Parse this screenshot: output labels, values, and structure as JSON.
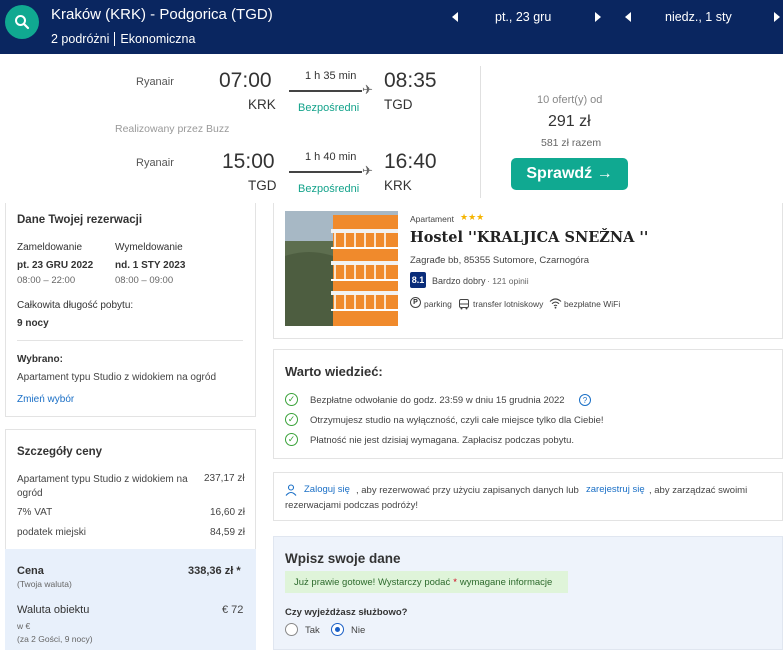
{
  "header": {
    "route": "Kraków (KRK) - Podgorica (TGD)",
    "passengers": "2 podróżni",
    "cabin": "Ekonomiczna",
    "depart_date": "pt., 23 gru",
    "return_date": "niedz., 1 sty"
  },
  "flights": {
    "outbound": {
      "carrier": "Ryanair",
      "dep_time": "07:00",
      "dep_code": "KRK",
      "duration": "1 h 35 min",
      "stops": "Bezpośredni",
      "arr_time": "08:35",
      "arr_code": "TGD"
    },
    "operated_by": "Realizowany przez Buzz",
    "inbound": {
      "carrier": "Ryanair",
      "dep_time": "15:00",
      "dep_code": "TGD",
      "duration": "1 h 40 min",
      "stops": "Bezpośredni",
      "arr_time": "16:40",
      "arr_code": "KRK"
    },
    "offers": "10 ofert(y) od",
    "price": "291 zł",
    "price_total": "581 zł razem",
    "check_label": "Sprawdź →"
  },
  "reservation": {
    "title": "Dane Twojej rezerwacji",
    "checkin_label": "Zameldowanie",
    "checkin_date": "pt. 23 GRU 2022",
    "checkin_hours": "08:00 – 22:00",
    "checkout_label": "Wymeldowanie",
    "checkout_date": "nd. 1 STY 2023",
    "checkout_hours": "08:00 – 09:00",
    "length_label": "Całkowita długość pobytu:",
    "length_value": "9 nocy",
    "selected_label": "Wybrano:",
    "selected_value": "Apartament typu Studio z widokiem na ogród",
    "change_link": "Zmień wybór"
  },
  "price_details": {
    "title": "Szczegóły ceny",
    "item_label": "Apartament typu Studio z widokiem na ogród",
    "item_value": "237,17 zł",
    "vat_label": "7% VAT",
    "vat_value": "16,60 zł",
    "tax_label": "podatek miejski",
    "tax_value": "84,59 zł",
    "total_label": "Cena",
    "total_note": "(Twoja waluta)",
    "total_value": "338,36 zł *",
    "currency_label": "Waluta obiektu",
    "currency_sub": "w €",
    "currency_note": "(za 2 Gości, 9 nocy)",
    "currency_value": "€ 72"
  },
  "hotel": {
    "type": "Apartament",
    "stars": "★★★",
    "name": "Hostel ''KRALJICA SNEŽNA ''",
    "address": "Zagrađe bb, 85355 Sutomore, Czarnogóra",
    "score": "8.1",
    "score_label": "Bardzo dobry",
    "reviews": "· 121 opinii",
    "amenity_parking": "parking",
    "amenity_transfer": "transfer lotniskowy",
    "amenity_wifi": "bezpłatne WiFi"
  },
  "good_to_know": {
    "title": "Warto wiedzieć:",
    "item1": "Bezpłatne odwołanie do godz. 23:59 w dniu 15 grudnia 2022",
    "item2": "Otrzymujesz studio na wyłączność, czyli całe miejsce tylko dla Ciebie!",
    "item3": "Płatność nie jest dzisiaj wymagana. Zapłacisz podczas pobytu."
  },
  "login": {
    "login_link": "Zaloguj się",
    "text1": ", aby rezerwować przy użyciu zapisanych danych lub",
    "register_link": "zarejestruj się",
    "text2": ", aby zarządzać swoimi",
    "text3": "rezerwacjami podczas podróży!"
  },
  "form": {
    "title": "Wpisz swoje dane",
    "notice_a": "Już prawie gotowe! Wystarczy podać",
    "notice_star": "*",
    "notice_b": "wymagane informacje",
    "business_q": "Czy wyjeżdżasz służbowo?",
    "yes": "Tak",
    "no": "Nie"
  }
}
